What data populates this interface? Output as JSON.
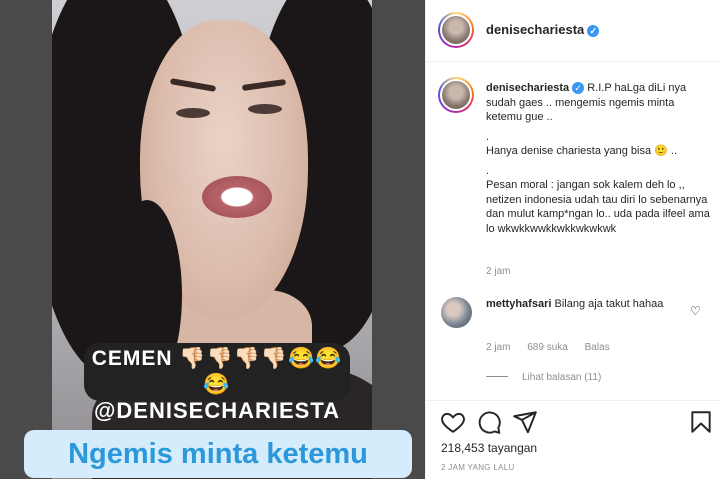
{
  "media": {
    "caption_line1": "CEMEN 👎🏻👎🏻👎🏻👎🏻😂😂😂",
    "caption_line2": "@DENISECHARIESTA",
    "banner": "Ngemis minta ketemu"
  },
  "post": {
    "username": "denisechariesta",
    "verified": true,
    "caption": {
      "username": "denisechariesta",
      "lines": [
        "R.I.P haLga diLi nya sudah gaes .. mengemis ngemis minta ketemu gue ..",
        ".",
        "Hanya denise chariesta yang bisa 🙂 ..",
        ".",
        "Pesan moral : jangan sok kalem deh lo ,, netizen indonesia udah tau diri lo sebenarnya dan mulut kamp*ngan lo.. uda pada ilfeel ama lo wkwkkwwkkwkkwkwkwk"
      ],
      "time": "2 jam"
    },
    "comment": {
      "username": "mettyhafsari",
      "text": "Bilang aja takut hahaa",
      "time": "2 jam",
      "likes": "689 suka",
      "reply_label": "Balas",
      "view_replies": "Lihat balasan (11)"
    },
    "views": "218,453 tayangan",
    "posted": "2 JAM YANG LALU"
  },
  "icons": [
    "heart-icon",
    "comment-icon",
    "share-icon",
    "bookmark-icon",
    "verified-badge-icon"
  ],
  "colors": {
    "accent": "#3897f0",
    "muted": "#8e8e8e",
    "banner_text": "#2b98d9",
    "banner_bg": "#d4ecfb"
  }
}
